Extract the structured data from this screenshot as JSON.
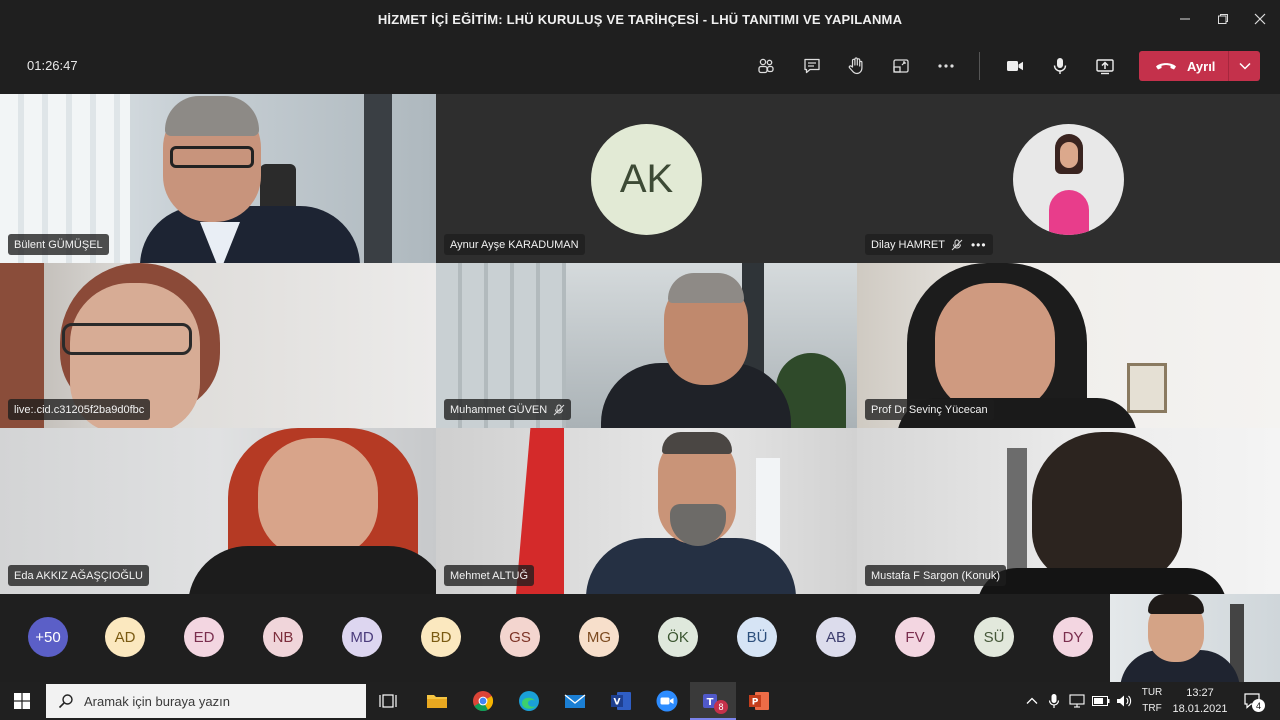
{
  "window": {
    "title": "HİZMET İÇİ EĞİTİM: LHÜ KURULUŞ VE TARİHÇESİ - LHÜ TANITIMI VE YAPILANMA"
  },
  "toolbar": {
    "timer": "01:26:47",
    "leave_label": "Ayrıl",
    "icons": [
      "participants-icon",
      "chat-icon",
      "raise-hand-icon",
      "rooms-icon",
      "more-icon",
      "camera-icon",
      "mic-icon",
      "share-icon"
    ]
  },
  "tiles": [
    {
      "name": "Bülent GÜMÜŞEL",
      "muted": false
    },
    {
      "name": "Aynur Ayşe KARADUMAN",
      "initials": "AK",
      "muted": false
    },
    {
      "name": "Dilay HAMRET",
      "muted": true,
      "more": "•••"
    },
    {
      "name": "live:.cid.c31205f2ba9d0fbc",
      "muted": false
    },
    {
      "name": "Muhammet GÜVEN",
      "muted": true
    },
    {
      "name": "Prof Dr Sevinç Yücecan",
      "muted": false
    },
    {
      "name": "Eda AKKIZ AĞAŞÇIOĞLU",
      "muted": false
    },
    {
      "name": "Mehmet ALTUĞ",
      "muted": false
    },
    {
      "name": "Mustafa F Sargon (Konuk)",
      "muted": false
    }
  ],
  "strip": {
    "overflow": "+50",
    "chips": [
      {
        "initials": "AD",
        "bg": "#fbe8bf",
        "fg": "#7a5a12"
      },
      {
        "initials": "ED",
        "bg": "#f3d6e1",
        "fg": "#7a2e4e"
      },
      {
        "initials": "NB",
        "bg": "#f0d5da",
        "fg": "#7c2e3c"
      },
      {
        "initials": "MD",
        "bg": "#ddd6f0",
        "fg": "#4b3c7c"
      },
      {
        "initials": "BD",
        "bg": "#fbe8bf",
        "fg": "#7a5a12"
      },
      {
        "initials": "GS",
        "bg": "#f3d5cf",
        "fg": "#7c3326"
      },
      {
        "initials": "MG",
        "bg": "#f7dfcb",
        "fg": "#7c4a20"
      },
      {
        "initials": "ÖK",
        "bg": "#dfe8dc",
        "fg": "#3a5530"
      },
      {
        "initials": "BÜ",
        "bg": "#d6e4f5",
        "fg": "#2c4f7c"
      },
      {
        "initials": "AB",
        "bg": "#dcdcec",
        "fg": "#3e3e6e"
      },
      {
        "initials": "FV",
        "bg": "#f3d6e1",
        "fg": "#7a2e4e"
      },
      {
        "initials": "SÜ",
        "bg": "#e2e8dc",
        "fg": "#46583a"
      },
      {
        "initials": "DY",
        "bg": "#f3d6e1",
        "fg": "#7a2e4e"
      }
    ]
  },
  "taskbar": {
    "search_placeholder": "Aramak için buraya yazın",
    "lang_top": "TUR",
    "lang_bottom": "TRF",
    "time": "13:27",
    "date": "18.01.2021",
    "notifications": "4",
    "teams_badge": "8"
  }
}
